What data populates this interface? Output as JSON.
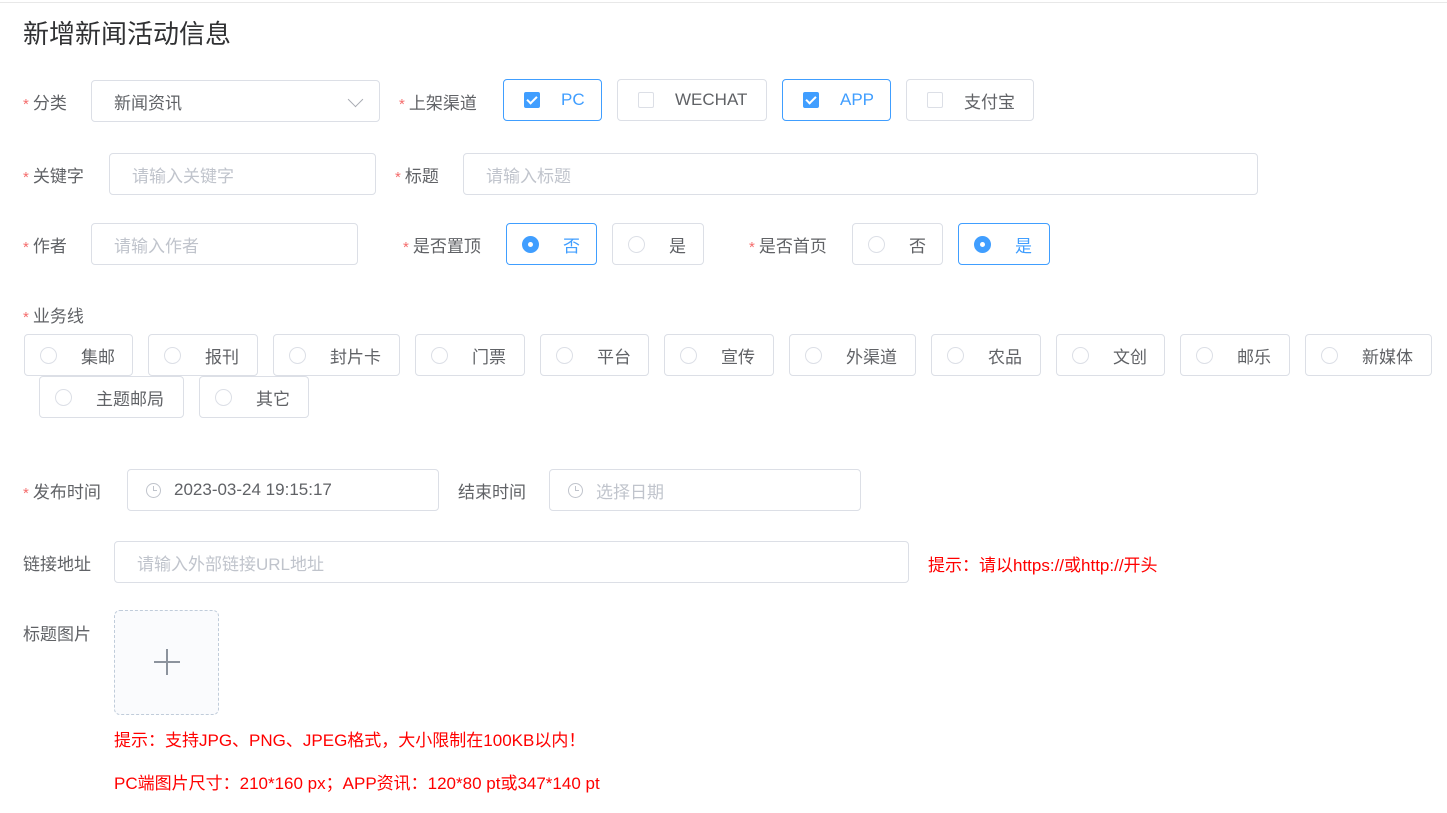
{
  "page": {
    "title": "新增新闻活动信息"
  },
  "form": {
    "category": {
      "label": "分类",
      "value": "新闻资讯"
    },
    "channels": {
      "label": "上架渠道",
      "options": [
        {
          "label": "PC",
          "checked": true
        },
        {
          "label": "WECHAT",
          "checked": false
        },
        {
          "label": "APP",
          "checked": true
        },
        {
          "label": "支付宝",
          "checked": false
        }
      ]
    },
    "keyword": {
      "label": "关键字",
      "placeholder": "请输入关键字"
    },
    "title_field": {
      "label": "标题",
      "placeholder": "请输入标题"
    },
    "author": {
      "label": "作者",
      "placeholder": "请输入作者"
    },
    "pinned": {
      "label": "是否置顶",
      "options": [
        "否",
        "是"
      ],
      "selected": "否"
    },
    "homepage": {
      "label": "是否首页",
      "options": [
        "否",
        "是"
      ],
      "selected": "是"
    },
    "business_line": {
      "label": "业务线",
      "options": [
        "集邮",
        "报刊",
        "封片卡",
        "门票",
        "平台",
        "宣传",
        "外渠道",
        "农品",
        "文创",
        "邮乐",
        "新媒体",
        "主题邮局",
        "其它"
      ]
    },
    "publish_time": {
      "label": "发布时间",
      "value": "2023-03-24 19:15:17"
    },
    "end_time": {
      "label": "结束时间",
      "placeholder": "选择日期"
    },
    "link": {
      "label": "链接地址",
      "placeholder": "请输入外部链接URL地址",
      "hint": "提示：请以https://或http://开头"
    },
    "title_image": {
      "label": "标题图片",
      "hint1": "提示：支持JPG、PNG、JPEG格式，大小限制在100KB以内！",
      "hint2": "PC端图片尺寸：210*160 px；APP资讯：120*80 pt或347*140 pt"
    }
  },
  "colors": {
    "primary": "#409eff",
    "required": "#f56c6c",
    "hint": "#ff0000"
  }
}
